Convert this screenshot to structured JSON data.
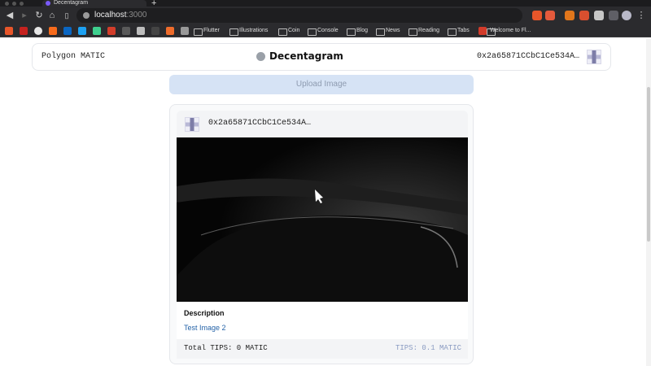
{
  "browser": {
    "tab_title": "Decentagram",
    "url_host": "localhost",
    "url_port": ":3000",
    "bookmarks": [
      "Flutter",
      "Illustrations",
      "Coin",
      "Console",
      "Blog",
      "News",
      "Reading",
      "Tabs",
      "Welcome to Fl..."
    ]
  },
  "header": {
    "network": "Polygon MATIC",
    "brand": "Decentagram",
    "account": "0x2a65871CCbC1Ce534A…"
  },
  "upload": {
    "label": "Upload Image"
  },
  "post": {
    "author": "0x2a65871CCbC1Ce534A…",
    "description_title": "Description",
    "description": "Test Image 2",
    "total_tips": "Total TIPS: 0 MATIC",
    "tip_action": "TIPS: 0.1 MATIC"
  },
  "colors": {
    "accent_light": "#d6e3f5",
    "link": "#2563a8",
    "tip": "#8a9bc2"
  }
}
